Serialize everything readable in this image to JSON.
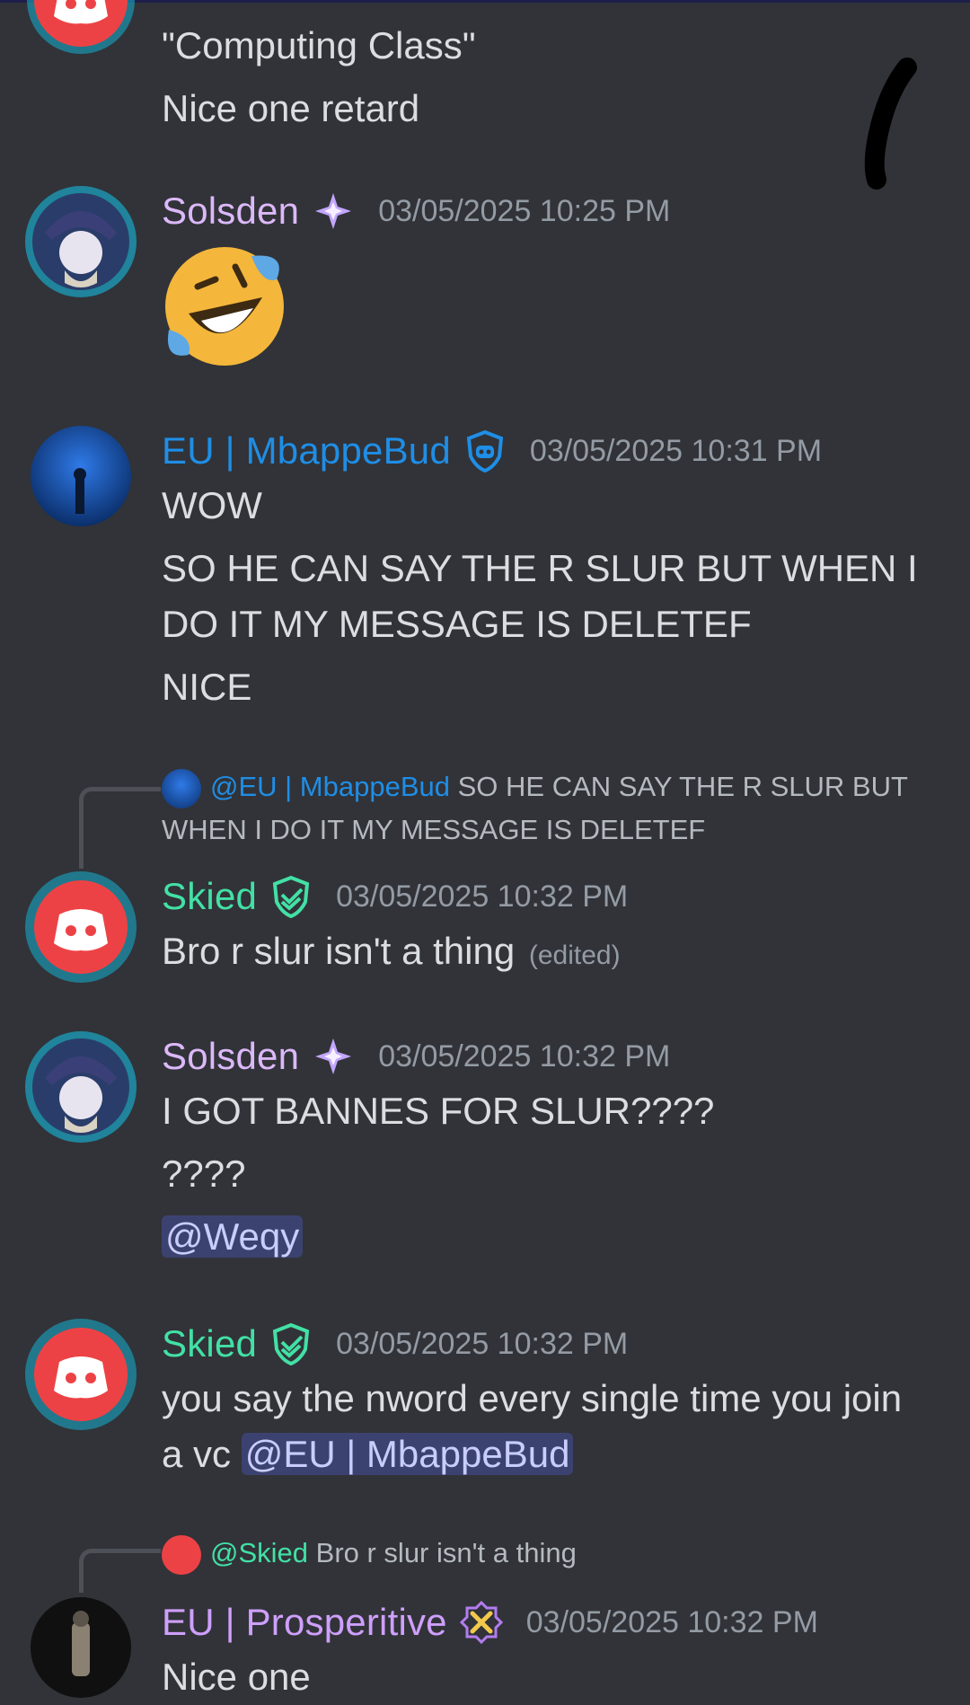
{
  "colors": {
    "background": "#313338",
    "solsden": "#dcb8f9",
    "mbappebud": "#1f8ee6",
    "skied": "#43e0a5",
    "prosperitive": "#cf9ffc",
    "timestamp": "#949ba4",
    "mention_bg": "#3c4270"
  },
  "top_message": {
    "line1": "\"Computing Class\"",
    "line2": "Nice one retard"
  },
  "messages": [
    {
      "author": "Solsden",
      "badge_icon": "sparkle-icon",
      "timestamp": "03/05/2025 10:25 PM",
      "emoji": "rolling-on-floor-laughing-emoji"
    },
    {
      "author": "EU | MbappeBud",
      "badge_icon": "shield-robot-icon",
      "timestamp": "03/05/2025 10:31 PM",
      "lines": [
        "WOW",
        "SO HE CAN SAY THE R SLUR BUT WHEN I",
        "DO IT MY MESSAGE IS DELETEF",
        "NICE"
      ]
    },
    {
      "reply": {
        "name": "@EU | MbappeBud",
        "text_line1": "SO HE CAN SAY THE R SLUR BUT",
        "text_line2": "WHEN I DO IT MY MESSAGE IS DELETEF"
      },
      "author": "Skied",
      "badge_icon": "shield-check-icon",
      "timestamp": "03/05/2025 10:32 PM",
      "text": "Bro r slur isn't a thing",
      "edited": "(edited)"
    },
    {
      "author": "Solsden",
      "badge_icon": "sparkle-icon",
      "timestamp": "03/05/2025 10:32 PM",
      "lines": [
        "I GOT BANNES FOR SLUR????",
        "????"
      ],
      "mention": "@Weqy"
    },
    {
      "author": "Skied",
      "badge_icon": "shield-check-icon",
      "timestamp": "03/05/2025 10:32 PM",
      "line1": "you say the nword every single time you join",
      "line2_prefix": "a vc",
      "mention": "@EU | MbappeBud"
    },
    {
      "reply": {
        "name": "@Skied",
        "text": "Bro r slur isn't a thing"
      },
      "author": "EU | Prosperitive",
      "badge_icon": "crossed-swords-icon",
      "timestamp": "03/05/2025 10:32 PM",
      "text": "Nice one"
    }
  ]
}
